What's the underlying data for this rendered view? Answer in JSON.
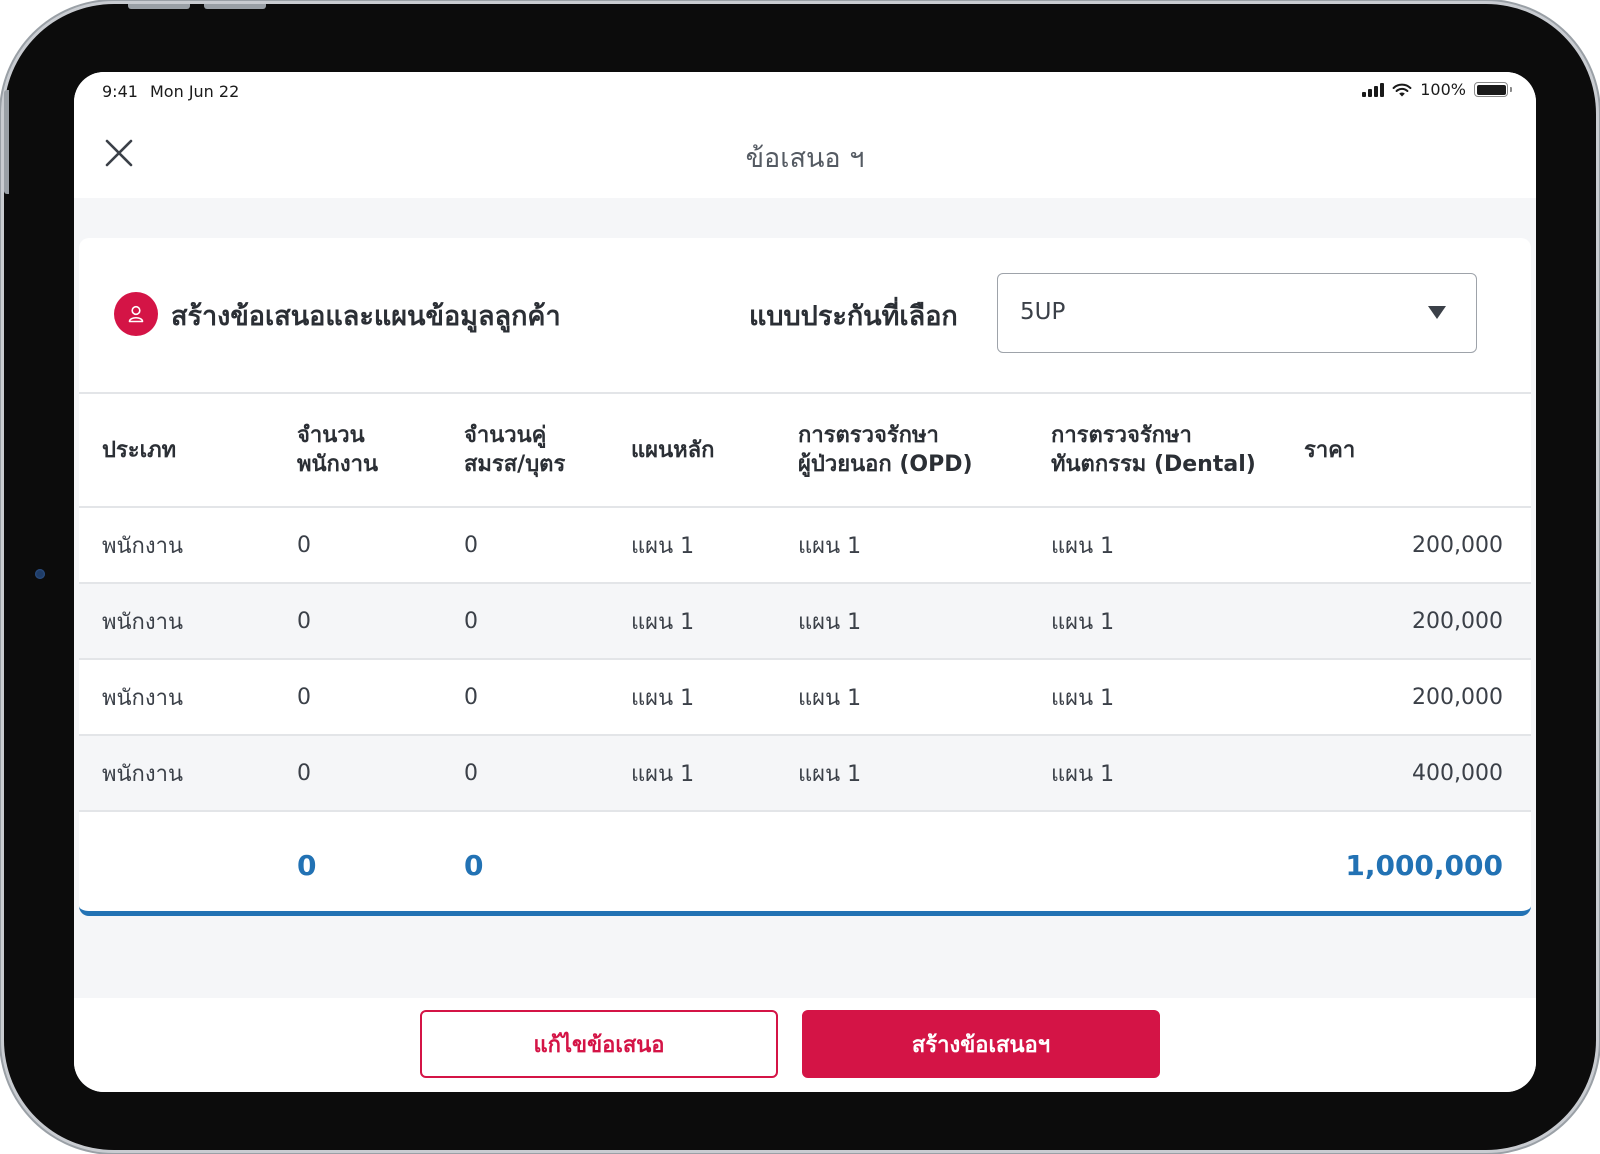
{
  "status_bar": {
    "time": "9:41",
    "date": "Mon Jun 22",
    "battery": "100%",
    "signal_icon": "cellular-signal-icon",
    "wifi_icon": "wifi-icon",
    "battery_icon": "battery-icon"
  },
  "nav": {
    "title": "ข้อเสนอ ฯ",
    "close_icon": "close-icon"
  },
  "card": {
    "title": "สร้างข้อเสนอและแผนข้อมูลลูกค้า",
    "person_icon": "person-icon",
    "select_label": "แบบประกันที่เลือก",
    "select_value": "5UP",
    "select_icon": "caret-down-icon"
  },
  "table": {
    "headers": [
      {
        "line1": "ประเภท",
        "line2": ""
      },
      {
        "line1": "จำนวน",
        "line2": "พนักงาน"
      },
      {
        "line1": "จำนวนคู่",
        "line2": "สมรส/บุตร"
      },
      {
        "line1": "แผนหลัก",
        "line2": ""
      },
      {
        "line1": "การตรวจรักษา",
        "line2": "ผู้ป่วยนอก (OPD)"
      },
      {
        "line1": "การตรวจรักษา",
        "line2": "ทันตกรรม (Dental)"
      },
      {
        "line1": "ราคา",
        "line2": ""
      }
    ],
    "rows": [
      {
        "type": "พนักงาน",
        "employees": "0",
        "spouse_children": "0",
        "main_plan": "แผน 1",
        "opd": "แผน 1",
        "dental": "แผน 1",
        "price": "200,000"
      },
      {
        "type": "พนักงาน",
        "employees": "0",
        "spouse_children": "0",
        "main_plan": "แผน 1",
        "opd": "แผน 1",
        "dental": "แผน 1",
        "price": "200,000"
      },
      {
        "type": "พนักงาน",
        "employees": "0",
        "spouse_children": "0",
        "main_plan": "แผน 1",
        "opd": "แผน 1",
        "dental": "แผน 1",
        "price": "200,000"
      },
      {
        "type": "พนักงาน",
        "employees": "0",
        "spouse_children": "0",
        "main_plan": "แผน 1",
        "opd": "แผน 1",
        "dental": "แผน 1",
        "price": "400,000"
      }
    ],
    "totals": {
      "employees": "0",
      "spouse_children": "0",
      "price": "1,000,000"
    }
  },
  "buttons": {
    "edit": "แก้ไขข้อเสนอ",
    "create": "สร้างข้อเสนอฯ"
  },
  "colors": {
    "accent_red": "#d41446",
    "total_blue": "#2272b4"
  }
}
